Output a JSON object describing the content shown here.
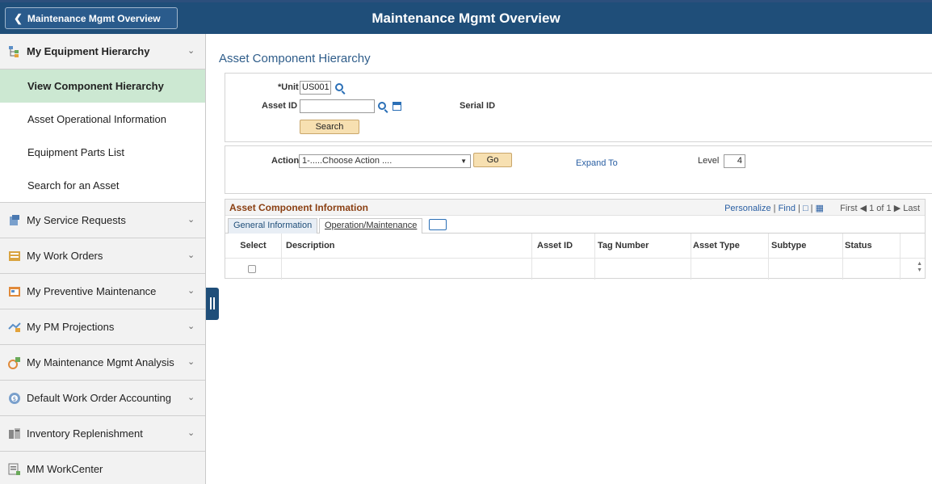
{
  "header": {
    "title": "Maintenance Mgmt Overview",
    "back_label": "Maintenance Mgmt Overview"
  },
  "sidebar": {
    "groups": [
      {
        "label": "My Equipment Hierarchy",
        "icon": "hierarchy-icon",
        "expanded": true,
        "items": [
          {
            "label": "View Component Hierarchy",
            "active": true
          },
          {
            "label": "Asset Operational Information"
          },
          {
            "label": "Equipment Parts List"
          },
          {
            "label": "Search for an Asset"
          }
        ]
      },
      {
        "label": "My Service Requests",
        "icon": "service-request-icon"
      },
      {
        "label": "My Work Orders",
        "icon": "work-order-icon"
      },
      {
        "label": "My Preventive Maintenance",
        "icon": "preventive-maintenance-icon"
      },
      {
        "label": "My PM Projections",
        "icon": "pm-projections-icon"
      },
      {
        "label": "My Maintenance Mgmt Analysis",
        "icon": "analysis-icon"
      },
      {
        "label": "Default Work Order Accounting",
        "icon": "accounting-icon"
      },
      {
        "label": "Inventory Replenishment",
        "icon": "inventory-icon"
      },
      {
        "label": "MM WorkCenter",
        "icon": "workcenter-icon"
      }
    ]
  },
  "main": {
    "page_title": "Asset Component Hierarchy",
    "search": {
      "unit_label": "*Unit",
      "unit_value": "US001",
      "asset_id_label": "Asset ID",
      "asset_id_value": "",
      "serial_id_label": "Serial ID",
      "search_button": "Search"
    },
    "action": {
      "action_label": "Action",
      "action_value": "1-.....Choose Action ....",
      "go_button": "Go",
      "expand_to": "Expand To",
      "level_label": "Level",
      "level_value": "4"
    },
    "grid": {
      "title": "Asset Component Information",
      "personalize": "Personalize",
      "find": "Find",
      "first": "First",
      "pager": "1 of 1",
      "last": "Last",
      "tabs": [
        "General Information",
        "Operation/Maintenance"
      ],
      "columns": [
        "Select",
        "Description",
        "Asset ID",
        "Tag Number",
        "Asset Type",
        "Subtype",
        "Status"
      ]
    }
  },
  "colors": {
    "header_bg": "#1f4e79",
    "active_item_bg": "#cce8d2",
    "grid_title": "#8a3f12",
    "link": "#2a5fa3",
    "button_bg": "#f7e0b1"
  }
}
